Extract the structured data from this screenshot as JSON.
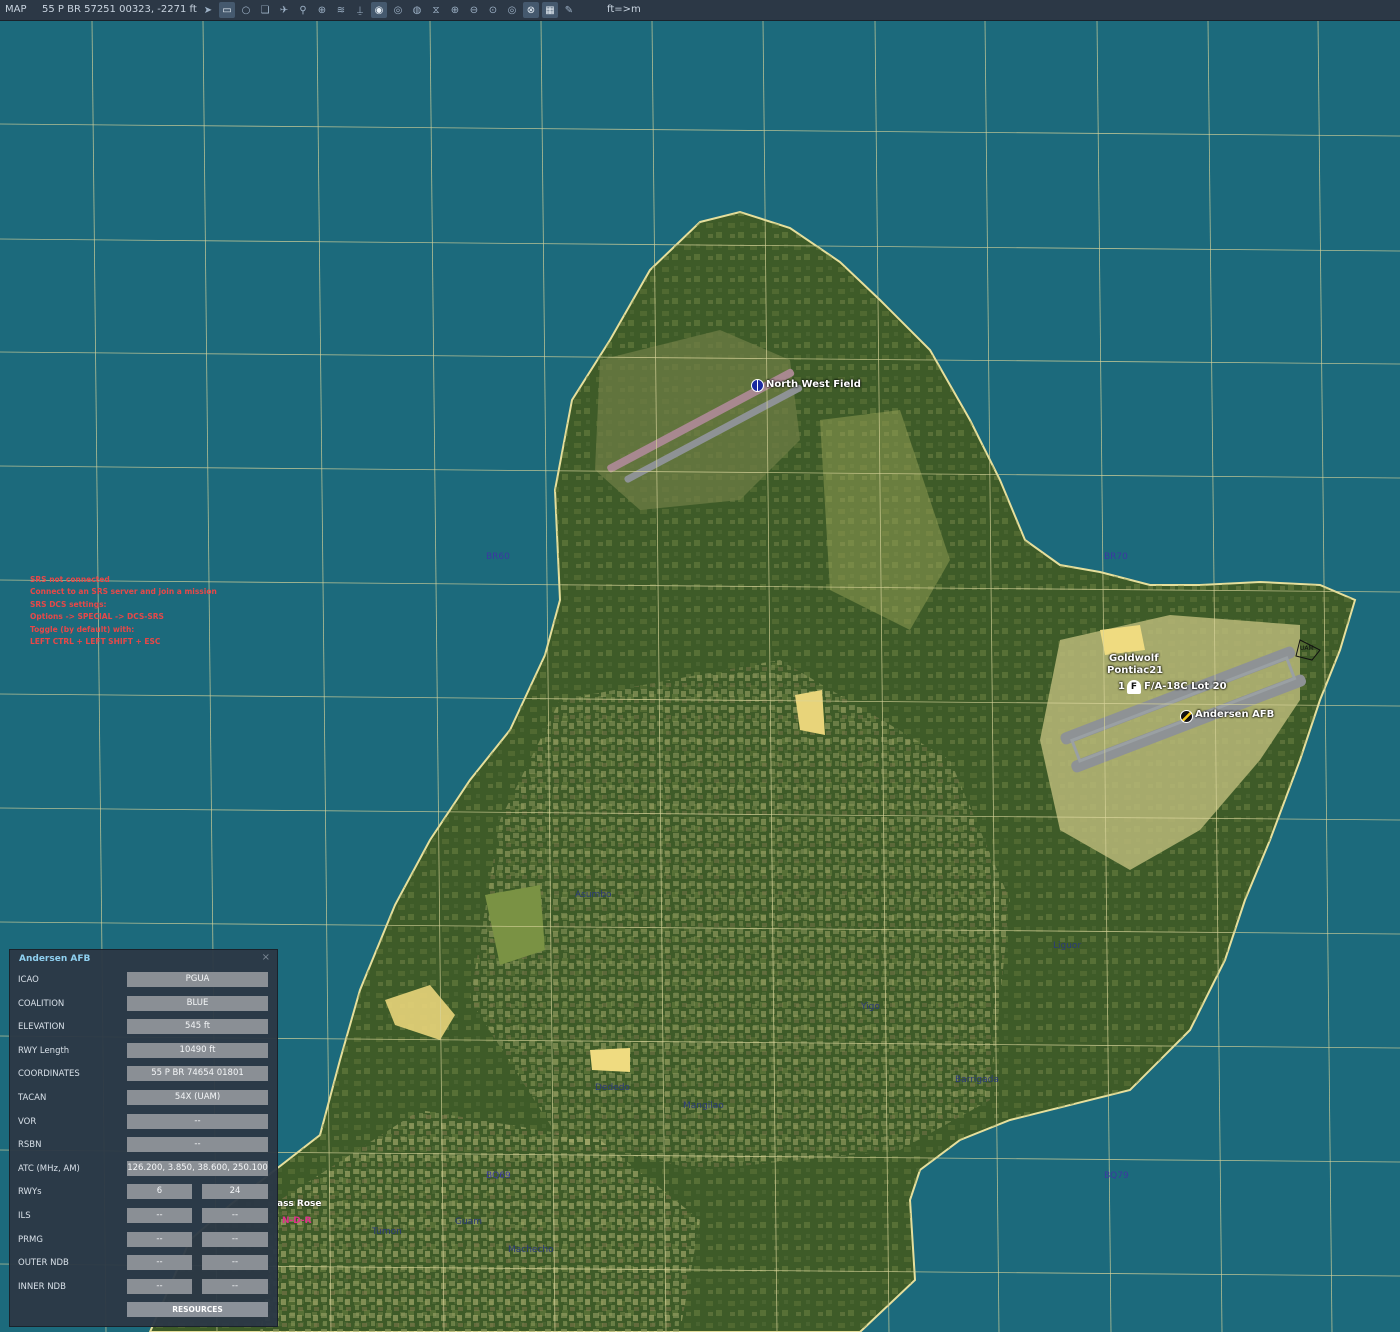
{
  "toolbar": {
    "mode": "MAP",
    "cursor_coords": "55 P BR 57251 00323, -2271 ft",
    "units": "ft=>m",
    "tool_icons": [
      "navigate-icon",
      "ruler-icon",
      "circle-icon",
      "layers-icon",
      "aircraft-icon",
      "route-icon",
      "target-icon",
      "signal-icon",
      "tower-icon",
      "view-icon",
      "view2-icon",
      "view3-icon",
      "filter-icon",
      "zoom-in-icon",
      "zoom-out-icon",
      "zoom-fit-icon",
      "radar-icon",
      "globe-icon",
      "grid-icon",
      "pencil-icon"
    ]
  },
  "map": {
    "grid_labels": [
      "BR60",
      "BR70",
      "BQ69",
      "BQ79"
    ],
    "places": [
      "Asumbo",
      "Liguor",
      "Yigo",
      "Dededo",
      "Barrigada",
      "Mangilao",
      "Tumon",
      "Guam",
      "Machecho"
    ],
    "airfields": [
      "North West Field",
      "Andersen AFB"
    ],
    "unit_group": {
      "name1": "Goldwolf",
      "name2": "Pontiac21",
      "count": "1",
      "marker": "F",
      "type": "F/A-18C Lot 20"
    },
    "compass_label": "ass Rose",
    "compass_sub": "N-D-R",
    "uam_label": "UAM"
  },
  "srs_messages": [
    "SRS not connected",
    "Connect to an SRS server and join a mission",
    "SRS DCS settings:",
    "Options -> SPECIAL -> DCS-SRS",
    "Toggle (by default) with:",
    "LEFT CTRL + LEFT SHIFT + ESC"
  ],
  "airfield_panel": {
    "title": "Andersen AFB",
    "close": "×",
    "rows": [
      {
        "label": "ICAO",
        "value": "PGUA"
      },
      {
        "label": "COALITION",
        "value": "BLUE"
      },
      {
        "label": "ELEVATION",
        "value": "545 ft"
      },
      {
        "label": "RWY Length",
        "value": "10490 ft"
      },
      {
        "label": "COORDINATES",
        "value": "55 P BR 74654 01801"
      },
      {
        "label": "TACAN",
        "value": "54X (UAM)"
      },
      {
        "label": "VOR",
        "value": "--"
      },
      {
        "label": "RSBN",
        "value": "--"
      },
      {
        "label": "ATC  (MHz, AM)",
        "value": "126.200, 3.850, 38.600, 250.100"
      }
    ],
    "pairs": [
      {
        "label": "RWYs",
        "left": "6",
        "right": "24"
      },
      {
        "label": "ILS",
        "left": "--",
        "right": "--"
      },
      {
        "label": "PRMG",
        "left": "--",
        "right": "--"
      },
      {
        "label": "OUTER NDB",
        "left": "--",
        "right": "--"
      },
      {
        "label": "INNER NDB",
        "left": "--",
        "right": "--"
      }
    ],
    "resources_label": "RESOURCES"
  },
  "colors": {
    "sea": "#1c6a7c",
    "land": "#3e5b28",
    "grid": "#d8d49a",
    "toolbar": "#2c3846",
    "panel": "#2c3846",
    "srs_text": "#e84848",
    "panel_title": "#8fd0f0"
  }
}
